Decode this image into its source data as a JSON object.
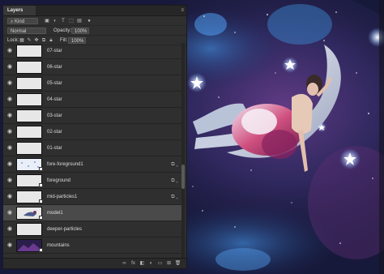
{
  "panel": {
    "tab_label": "Layers",
    "menu_glyph": "≡",
    "filter": {
      "kind_label": "Kind"
    },
    "blend_mode": "Normal",
    "opacity_label": "Opacity:",
    "opacity_value": "100%",
    "lock_label": "Lock:",
    "fill_label": "Fill:",
    "fill_value": "100%"
  },
  "layers": [
    {
      "name": "07-star",
      "visible": true,
      "thumb": "white",
      "fx": false,
      "selected": false
    },
    {
      "name": "06-star",
      "visible": true,
      "thumb": "white",
      "fx": false,
      "selected": false
    },
    {
      "name": "05-star",
      "visible": true,
      "thumb": "white",
      "fx": false,
      "selected": false
    },
    {
      "name": "04-star",
      "visible": true,
      "thumb": "white",
      "fx": false,
      "selected": false
    },
    {
      "name": "03-star",
      "visible": true,
      "thumb": "white",
      "fx": false,
      "selected": false
    },
    {
      "name": "02-star",
      "visible": true,
      "thumb": "white",
      "fx": false,
      "selected": false
    },
    {
      "name": "01-star",
      "visible": true,
      "thumb": "white",
      "fx": false,
      "selected": false
    },
    {
      "name": "fore-foreground1",
      "visible": true,
      "thumb": "particles",
      "fx": true,
      "selected": false
    },
    {
      "name": "foreground",
      "visible": true,
      "thumb": "white",
      "fx": true,
      "selected": false
    },
    {
      "name": "mid-particles1",
      "visible": true,
      "thumb": "white",
      "fx": true,
      "selected": false
    },
    {
      "name": "model1",
      "visible": true,
      "thumb": "model",
      "fx": false,
      "selected": true
    },
    {
      "name": "deeper-particles",
      "visible": true,
      "thumb": "white",
      "fx": false,
      "selected": false
    },
    {
      "name": "mountains",
      "visible": true,
      "thumb": "mountains",
      "fx": false,
      "selected": false
    }
  ],
  "footer_icons": [
    "link-icon",
    "fx-icon",
    "mask-icon",
    "adjustment-icon",
    "folder-icon",
    "new-layer-icon",
    "trash-icon"
  ],
  "colors": {
    "panel_bg": "#2f2f2f",
    "selected_row": "#4a4a4a",
    "space_bg": "#1b1d3a"
  }
}
